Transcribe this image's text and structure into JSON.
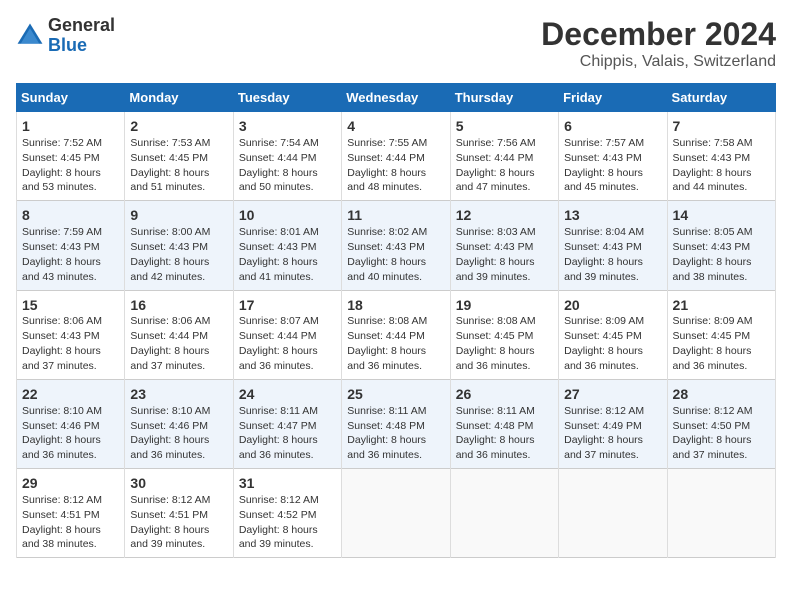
{
  "logo": {
    "general": "General",
    "blue": "Blue"
  },
  "title": "December 2024",
  "subtitle": "Chippis, Valais, Switzerland",
  "days_of_week": [
    "Sunday",
    "Monday",
    "Tuesday",
    "Wednesday",
    "Thursday",
    "Friday",
    "Saturday"
  ],
  "weeks": [
    [
      {
        "day": "1",
        "sunrise": "7:52 AM",
        "sunset": "4:45 PM",
        "daylight": "8 hours and 53 minutes."
      },
      {
        "day": "2",
        "sunrise": "7:53 AM",
        "sunset": "4:45 PM",
        "daylight": "8 hours and 51 minutes."
      },
      {
        "day": "3",
        "sunrise": "7:54 AM",
        "sunset": "4:44 PM",
        "daylight": "8 hours and 50 minutes."
      },
      {
        "day": "4",
        "sunrise": "7:55 AM",
        "sunset": "4:44 PM",
        "daylight": "8 hours and 48 minutes."
      },
      {
        "day": "5",
        "sunrise": "7:56 AM",
        "sunset": "4:44 PM",
        "daylight": "8 hours and 47 minutes."
      },
      {
        "day": "6",
        "sunrise": "7:57 AM",
        "sunset": "4:43 PM",
        "daylight": "8 hours and 45 minutes."
      },
      {
        "day": "7",
        "sunrise": "7:58 AM",
        "sunset": "4:43 PM",
        "daylight": "8 hours and 44 minutes."
      }
    ],
    [
      {
        "day": "8",
        "sunrise": "7:59 AM",
        "sunset": "4:43 PM",
        "daylight": "8 hours and 43 minutes."
      },
      {
        "day": "9",
        "sunrise": "8:00 AM",
        "sunset": "4:43 PM",
        "daylight": "8 hours and 42 minutes."
      },
      {
        "day": "10",
        "sunrise": "8:01 AM",
        "sunset": "4:43 PM",
        "daylight": "8 hours and 41 minutes."
      },
      {
        "day": "11",
        "sunrise": "8:02 AM",
        "sunset": "4:43 PM",
        "daylight": "8 hours and 40 minutes."
      },
      {
        "day": "12",
        "sunrise": "8:03 AM",
        "sunset": "4:43 PM",
        "daylight": "8 hours and 39 minutes."
      },
      {
        "day": "13",
        "sunrise": "8:04 AM",
        "sunset": "4:43 PM",
        "daylight": "8 hours and 39 minutes."
      },
      {
        "day": "14",
        "sunrise": "8:05 AM",
        "sunset": "4:43 PM",
        "daylight": "8 hours and 38 minutes."
      }
    ],
    [
      {
        "day": "15",
        "sunrise": "8:06 AM",
        "sunset": "4:43 PM",
        "daylight": "8 hours and 37 minutes."
      },
      {
        "day": "16",
        "sunrise": "8:06 AM",
        "sunset": "4:44 PM",
        "daylight": "8 hours and 37 minutes."
      },
      {
        "day": "17",
        "sunrise": "8:07 AM",
        "sunset": "4:44 PM",
        "daylight": "8 hours and 36 minutes."
      },
      {
        "day": "18",
        "sunrise": "8:08 AM",
        "sunset": "4:44 PM",
        "daylight": "8 hours and 36 minutes."
      },
      {
        "day": "19",
        "sunrise": "8:08 AM",
        "sunset": "4:45 PM",
        "daylight": "8 hours and 36 minutes."
      },
      {
        "day": "20",
        "sunrise": "8:09 AM",
        "sunset": "4:45 PM",
        "daylight": "8 hours and 36 minutes."
      },
      {
        "day": "21",
        "sunrise": "8:09 AM",
        "sunset": "4:45 PM",
        "daylight": "8 hours and 36 minutes."
      }
    ],
    [
      {
        "day": "22",
        "sunrise": "8:10 AM",
        "sunset": "4:46 PM",
        "daylight": "8 hours and 36 minutes."
      },
      {
        "day": "23",
        "sunrise": "8:10 AM",
        "sunset": "4:46 PM",
        "daylight": "8 hours and 36 minutes."
      },
      {
        "day": "24",
        "sunrise": "8:11 AM",
        "sunset": "4:47 PM",
        "daylight": "8 hours and 36 minutes."
      },
      {
        "day": "25",
        "sunrise": "8:11 AM",
        "sunset": "4:48 PM",
        "daylight": "8 hours and 36 minutes."
      },
      {
        "day": "26",
        "sunrise": "8:11 AM",
        "sunset": "4:48 PM",
        "daylight": "8 hours and 36 minutes."
      },
      {
        "day": "27",
        "sunrise": "8:12 AM",
        "sunset": "4:49 PM",
        "daylight": "8 hours and 37 minutes."
      },
      {
        "day": "28",
        "sunrise": "8:12 AM",
        "sunset": "4:50 PM",
        "daylight": "8 hours and 37 minutes."
      }
    ],
    [
      {
        "day": "29",
        "sunrise": "8:12 AM",
        "sunset": "4:51 PM",
        "daylight": "8 hours and 38 minutes."
      },
      {
        "day": "30",
        "sunrise": "8:12 AM",
        "sunset": "4:51 PM",
        "daylight": "8 hours and 39 minutes."
      },
      {
        "day": "31",
        "sunrise": "8:12 AM",
        "sunset": "4:52 PM",
        "daylight": "8 hours and 39 minutes."
      },
      null,
      null,
      null,
      null
    ]
  ],
  "labels": {
    "sunrise": "Sunrise:",
    "sunset": "Sunset:",
    "daylight": "Daylight:"
  }
}
